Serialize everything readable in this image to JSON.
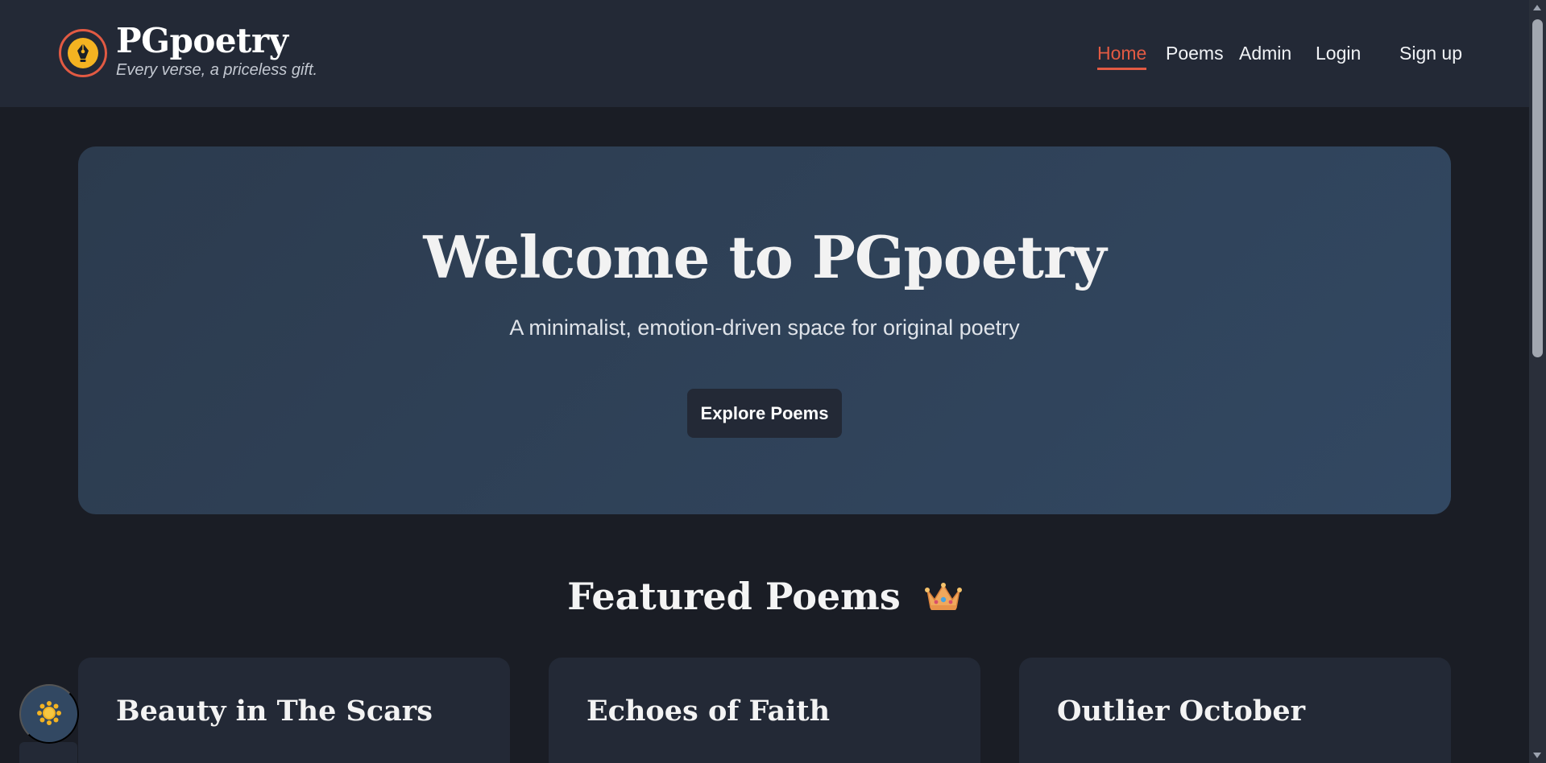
{
  "brand": {
    "name": "PGpoetry",
    "tagline": "Every verse, a priceless gift.",
    "logo_icon": "fountain-pen-nib-icon",
    "accent_color": "#e25a43",
    "logo_fill_color": "#f4b321"
  },
  "nav": {
    "items": [
      {
        "label": "Home",
        "active": true
      },
      {
        "label": "Poems",
        "active": false
      },
      {
        "label": "Admin",
        "active": false
      },
      {
        "label": "Login",
        "active": false
      },
      {
        "label": "Sign up",
        "active": false
      }
    ]
  },
  "hero": {
    "title": "Welcome to PGpoetry",
    "subtitle": "A minimalist, emotion-driven space for original poetry",
    "button_label": "Explore Poems"
  },
  "featured": {
    "title": "Featured Poems",
    "title_icon": "crown-icon",
    "cards": [
      {
        "title": "Beauty in The Scars"
      },
      {
        "title": "Echoes of Faith"
      },
      {
        "title": "Outlier October"
      }
    ]
  },
  "theme_toggle": {
    "icon": "sun-icon"
  }
}
